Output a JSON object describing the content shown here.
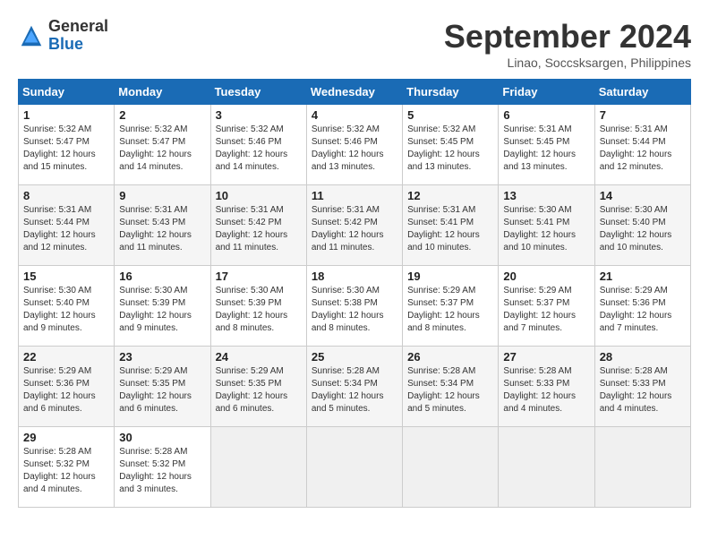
{
  "header": {
    "logo_general": "General",
    "logo_blue": "Blue",
    "month_title": "September 2024",
    "location": "Linao, Soccsksargen, Philippines"
  },
  "weekdays": [
    "Sunday",
    "Monday",
    "Tuesday",
    "Wednesday",
    "Thursday",
    "Friday",
    "Saturday"
  ],
  "weeks": [
    [
      {
        "day": "1",
        "sunrise": "Sunrise: 5:32 AM",
        "sunset": "Sunset: 5:47 PM",
        "daylight": "Daylight: 12 hours and 15 minutes."
      },
      {
        "day": "2",
        "sunrise": "Sunrise: 5:32 AM",
        "sunset": "Sunset: 5:47 PM",
        "daylight": "Daylight: 12 hours and 14 minutes."
      },
      {
        "day": "3",
        "sunrise": "Sunrise: 5:32 AM",
        "sunset": "Sunset: 5:46 PM",
        "daylight": "Daylight: 12 hours and 14 minutes."
      },
      {
        "day": "4",
        "sunrise": "Sunrise: 5:32 AM",
        "sunset": "Sunset: 5:46 PM",
        "daylight": "Daylight: 12 hours and 13 minutes."
      },
      {
        "day": "5",
        "sunrise": "Sunrise: 5:32 AM",
        "sunset": "Sunset: 5:45 PM",
        "daylight": "Daylight: 12 hours and 13 minutes."
      },
      {
        "day": "6",
        "sunrise": "Sunrise: 5:31 AM",
        "sunset": "Sunset: 5:45 PM",
        "daylight": "Daylight: 12 hours and 13 minutes."
      },
      {
        "day": "7",
        "sunrise": "Sunrise: 5:31 AM",
        "sunset": "Sunset: 5:44 PM",
        "daylight": "Daylight: 12 hours and 12 minutes."
      }
    ],
    [
      {
        "day": "8",
        "sunrise": "Sunrise: 5:31 AM",
        "sunset": "Sunset: 5:44 PM",
        "daylight": "Daylight: 12 hours and 12 minutes."
      },
      {
        "day": "9",
        "sunrise": "Sunrise: 5:31 AM",
        "sunset": "Sunset: 5:43 PM",
        "daylight": "Daylight: 12 hours and 11 minutes."
      },
      {
        "day": "10",
        "sunrise": "Sunrise: 5:31 AM",
        "sunset": "Sunset: 5:42 PM",
        "daylight": "Daylight: 12 hours and 11 minutes."
      },
      {
        "day": "11",
        "sunrise": "Sunrise: 5:31 AM",
        "sunset": "Sunset: 5:42 PM",
        "daylight": "Daylight: 12 hours and 11 minutes."
      },
      {
        "day": "12",
        "sunrise": "Sunrise: 5:31 AM",
        "sunset": "Sunset: 5:41 PM",
        "daylight": "Daylight: 12 hours and 10 minutes."
      },
      {
        "day": "13",
        "sunrise": "Sunrise: 5:30 AM",
        "sunset": "Sunset: 5:41 PM",
        "daylight": "Daylight: 12 hours and 10 minutes."
      },
      {
        "day": "14",
        "sunrise": "Sunrise: 5:30 AM",
        "sunset": "Sunset: 5:40 PM",
        "daylight": "Daylight: 12 hours and 10 minutes."
      }
    ],
    [
      {
        "day": "15",
        "sunrise": "Sunrise: 5:30 AM",
        "sunset": "Sunset: 5:40 PM",
        "daylight": "Daylight: 12 hours and 9 minutes."
      },
      {
        "day": "16",
        "sunrise": "Sunrise: 5:30 AM",
        "sunset": "Sunset: 5:39 PM",
        "daylight": "Daylight: 12 hours and 9 minutes."
      },
      {
        "day": "17",
        "sunrise": "Sunrise: 5:30 AM",
        "sunset": "Sunset: 5:39 PM",
        "daylight": "Daylight: 12 hours and 8 minutes."
      },
      {
        "day": "18",
        "sunrise": "Sunrise: 5:30 AM",
        "sunset": "Sunset: 5:38 PM",
        "daylight": "Daylight: 12 hours and 8 minutes."
      },
      {
        "day": "19",
        "sunrise": "Sunrise: 5:29 AM",
        "sunset": "Sunset: 5:37 PM",
        "daylight": "Daylight: 12 hours and 8 minutes."
      },
      {
        "day": "20",
        "sunrise": "Sunrise: 5:29 AM",
        "sunset": "Sunset: 5:37 PM",
        "daylight": "Daylight: 12 hours and 7 minutes."
      },
      {
        "day": "21",
        "sunrise": "Sunrise: 5:29 AM",
        "sunset": "Sunset: 5:36 PM",
        "daylight": "Daylight: 12 hours and 7 minutes."
      }
    ],
    [
      {
        "day": "22",
        "sunrise": "Sunrise: 5:29 AM",
        "sunset": "Sunset: 5:36 PM",
        "daylight": "Daylight: 12 hours and 6 minutes."
      },
      {
        "day": "23",
        "sunrise": "Sunrise: 5:29 AM",
        "sunset": "Sunset: 5:35 PM",
        "daylight": "Daylight: 12 hours and 6 minutes."
      },
      {
        "day": "24",
        "sunrise": "Sunrise: 5:29 AM",
        "sunset": "Sunset: 5:35 PM",
        "daylight": "Daylight: 12 hours and 6 minutes."
      },
      {
        "day": "25",
        "sunrise": "Sunrise: 5:28 AM",
        "sunset": "Sunset: 5:34 PM",
        "daylight": "Daylight: 12 hours and 5 minutes."
      },
      {
        "day": "26",
        "sunrise": "Sunrise: 5:28 AM",
        "sunset": "Sunset: 5:34 PM",
        "daylight": "Daylight: 12 hours and 5 minutes."
      },
      {
        "day": "27",
        "sunrise": "Sunrise: 5:28 AM",
        "sunset": "Sunset: 5:33 PM",
        "daylight": "Daylight: 12 hours and 4 minutes."
      },
      {
        "day": "28",
        "sunrise": "Sunrise: 5:28 AM",
        "sunset": "Sunset: 5:33 PM",
        "daylight": "Daylight: 12 hours and 4 minutes."
      }
    ],
    [
      {
        "day": "29",
        "sunrise": "Sunrise: 5:28 AM",
        "sunset": "Sunset: 5:32 PM",
        "daylight": "Daylight: 12 hours and 4 minutes."
      },
      {
        "day": "30",
        "sunrise": "Sunrise: 5:28 AM",
        "sunset": "Sunset: 5:32 PM",
        "daylight": "Daylight: 12 hours and 3 minutes."
      },
      null,
      null,
      null,
      null,
      null
    ]
  ]
}
